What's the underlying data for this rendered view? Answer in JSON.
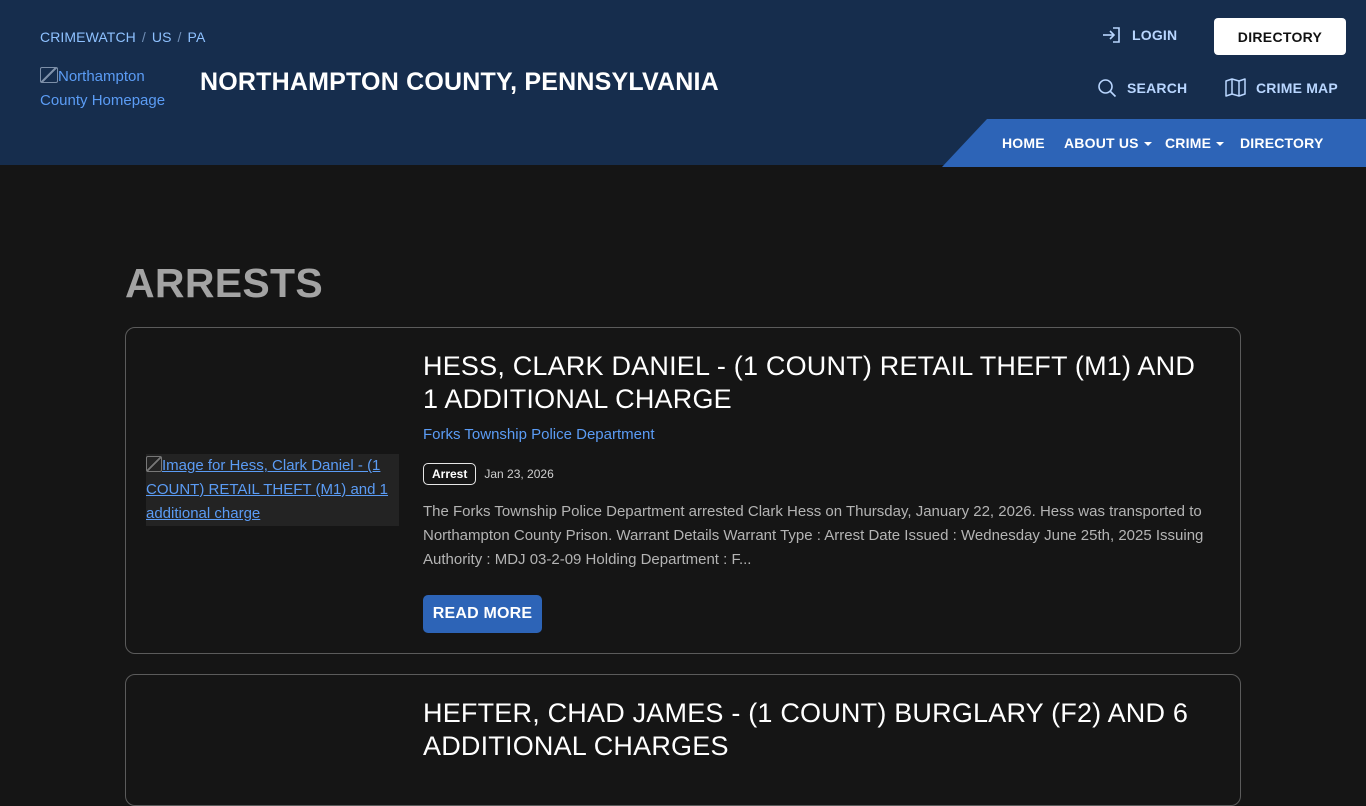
{
  "header": {
    "breadcrumb": [
      "CRIMEWATCH",
      "US",
      "PA"
    ],
    "breadcrumb_sep": "/",
    "logo_alt": "Northampton County Homepage",
    "site_title": "NORTHAMPTON COUNTY, PENNSYLVANIA",
    "login_label": "LOGIN",
    "directory_button": "DIRECTORY",
    "search_label": "SEARCH",
    "crime_map_label": "CRIME MAP"
  },
  "nav": {
    "items": [
      {
        "label": "HOME",
        "dropdown": false
      },
      {
        "label": "ABOUT US",
        "dropdown": true
      },
      {
        "label": "CRIME",
        "dropdown": true
      },
      {
        "label": "DIRECTORY",
        "dropdown": false
      }
    ]
  },
  "main": {
    "page_title": "ARRESTS",
    "posts": [
      {
        "image_alt": "Image for Hess, Clark Daniel - (1 COUNT) RETAIL THEFT (M1) and 1 additional charge",
        "title": "HESS, CLARK DANIEL - (1 COUNT) RETAIL THEFT (M1) AND 1 ADDITIONAL CHARGE",
        "department": "Forks Township Police Department",
        "badge": "Arrest",
        "date": "Jan 23, 2026",
        "excerpt": "The Forks Township Police Department arrested Clark Hess on Thursday, January 22, 2026. Hess was transported to Northampton County Prison.  Warrant Details Warrant Type : Arrest Date Issued : Wednesday June 25th, 2025 Issuing Authority : MDJ 03-2-09 Holding Department : F...",
        "button": "READ MORE"
      },
      {
        "title": "HEFTER, CHAD JAMES - (1 COUNT) BURGLARY (F2) AND 6 ADDITIONAL CHARGES"
      }
    ]
  },
  "colors": {
    "header_bg": "#162d4d",
    "accent_blue": "#2d64b7",
    "link_blue": "#5b9cf5",
    "page_bg": "#151515"
  },
  "icons": [
    "login-icon",
    "search-icon",
    "map-icon",
    "caret-down-icon"
  ]
}
